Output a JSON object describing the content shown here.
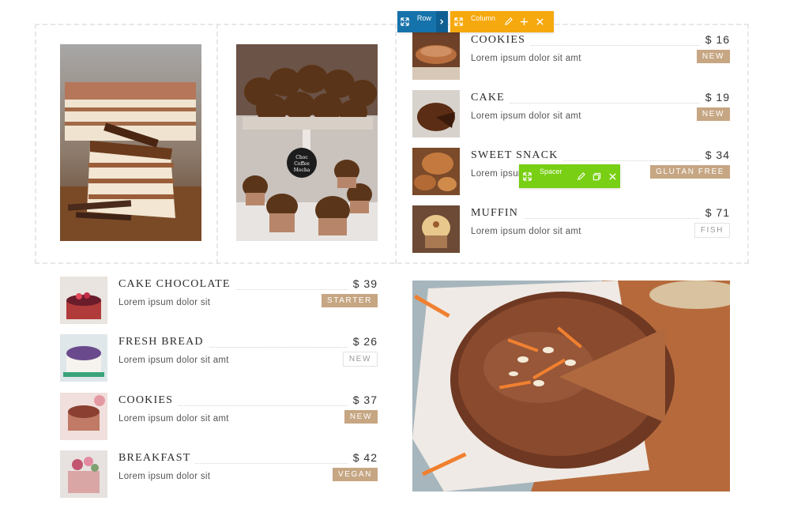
{
  "colors": {
    "accent": "#c6a683",
    "row_toolbar": "#1672ab",
    "column_toolbar": "#f6a90e",
    "spacer_toolbar": "#78cf13"
  },
  "builder": {
    "row_label": "Row",
    "column_label": "Column",
    "spacer_label": "Spacer"
  },
  "photos": {
    "top_left": "layered-cake-photo",
    "top_middle": "cupcakes-stand-photo",
    "stand_sign": [
      "Choc",
      "Coffee",
      "Mocha"
    ],
    "bottom_right": "carrot-cake-photo"
  },
  "menu_right": [
    {
      "name": "COOKIES",
      "desc": "Lorem ipsum dolor sit amt",
      "price": "$ 16",
      "tag": "NEW",
      "tag_style": "filled"
    },
    {
      "name": "CAKE",
      "desc": "Lorem ipsum dolor sit amt",
      "price": "$ 19",
      "tag": "NEW",
      "tag_style": "filled"
    },
    {
      "name": "SWEET SNACK",
      "desc": "Lorem ipsum dolor sit amt",
      "price": "$ 34",
      "tag": "GLUTAN FREE",
      "tag_style": "filled"
    },
    {
      "name": "MUFFIN",
      "desc": "Lorem ipsum dolor sit amt",
      "price": "$ 71",
      "tag": "FISH",
      "tag_style": "outline"
    }
  ],
  "menu_left": [
    {
      "name": "CAKE CHOCOLATE",
      "desc": "Lorem ipsum dolor sit",
      "price": "$ 39",
      "tag": "STARTER",
      "tag_style": "filled"
    },
    {
      "name": "FRESH BREAD",
      "desc": "Lorem ipsum dolor sit amt",
      "price": "$ 26",
      "tag": "NEW",
      "tag_style": "outline"
    },
    {
      "name": "COOKIES",
      "desc": "Lorem ipsum dolor sit amt",
      "price": "$ 37",
      "tag": "NEW",
      "tag_style": "filled"
    },
    {
      "name": "BREAKFAST",
      "desc": "Lorem ipsum dolor sit",
      "price": "$ 42",
      "tag": "VEGAN",
      "tag_style": "filled"
    }
  ]
}
